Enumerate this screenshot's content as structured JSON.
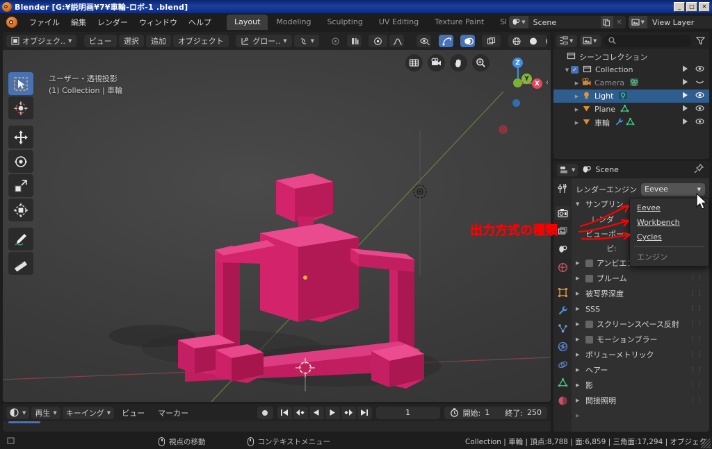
{
  "window": {
    "title": "Blender  [G:¥説明画¥7¥車輪-ロボ-1 .blend]",
    "minimize": "_",
    "maximize": "□",
    "close": "✕"
  },
  "topbar": {
    "menus": [
      "ファイル",
      "編集",
      "レンダー",
      "ウィンドウ",
      "ヘルプ"
    ],
    "workspaces": [
      {
        "label": "Layout",
        "active": true
      },
      {
        "label": "Modeling",
        "active": false
      },
      {
        "label": "Sculpting",
        "active": false
      },
      {
        "label": "UV Editing",
        "active": false
      },
      {
        "label": "Texture Paint",
        "active": false
      },
      {
        "label": "Sha",
        "active": false
      }
    ],
    "scene_name": "Scene",
    "view_layer_name": "View Layer"
  },
  "viewport": {
    "mode": "オブジェク..",
    "menus": [
      "ビュー",
      "選択",
      "追加",
      "オブジェクト"
    ],
    "transform_orientation": "グロー..",
    "overlay_line1": "ユーザー・透視投影",
    "overlay_line2": "(1) Collection | 車輪",
    "gizmo_axes": [
      "Z",
      "Y",
      "X"
    ],
    "tools": [
      "tweak-select-box-tool",
      "cursor-tool",
      "move-tool",
      "rotate-tool",
      "scale-tool",
      "transform-tool",
      "annotate-tool",
      "measure-tool"
    ],
    "nav_buttons": [
      "toggle-camera-grid",
      "camera-view",
      "pan-view",
      "zoom-view"
    ]
  },
  "outliner": {
    "search_placeholder": "",
    "rows": [
      {
        "label": "シーンコレクション",
        "indent": 0,
        "icon": "collection-icon",
        "selected": false,
        "has_disc": false,
        "has_check": false,
        "visible_ico": "",
        "hide_ico": ""
      },
      {
        "label": "Collection",
        "indent": 1,
        "icon": "collection-icon",
        "selected": false,
        "has_disc": true,
        "has_check": true,
        "visible_ico": "▶",
        "hide_ico": "◉"
      },
      {
        "label": "Camera",
        "indent": 2,
        "icon": "camera-icon",
        "selected": false,
        "has_disc": true,
        "has_check": false,
        "visible_ico": "▶",
        "hide_ico": "◡",
        "dim": true
      },
      {
        "label": "Light",
        "indent": 2,
        "icon": "light-icon",
        "selected": true,
        "has_disc": true,
        "has_check": false,
        "visible_ico": "▶",
        "hide_ico": "◉"
      },
      {
        "label": "Plane",
        "indent": 2,
        "icon": "mesh-icon",
        "selected": false,
        "has_disc": true,
        "has_check": false,
        "visible_ico": "▶",
        "hide_ico": "◉"
      },
      {
        "label": "車輪",
        "indent": 2,
        "icon": "mesh-icon",
        "selected": false,
        "has_disc": true,
        "has_check": false,
        "visible_ico": "▶",
        "hide_ico": "◉"
      }
    ]
  },
  "properties": {
    "breadcrumb": "Scene",
    "render_engine_label": "レンダーエンジン",
    "render_engine_value": "Eevee",
    "sampling_label": "サンプリン..",
    "render_sub_label": "レンダ",
    "viewport_sub_label": "ビューポー",
    "pixel_label": "ピ:",
    "dropdown_items": [
      {
        "label": "Eevee",
        "underline": "E",
        "dim": false
      },
      {
        "label": "Workbench",
        "underline": "W",
        "dim": false
      },
      {
        "label": "Cycles",
        "underline": "C",
        "dim": false
      },
      {
        "label": "エンジン",
        "underline": "",
        "dim": true
      }
    ],
    "sections": [
      {
        "label": "アンビエントオクルージョン(:",
        "checkbox": true
      },
      {
        "label": "ブルーム",
        "checkbox": true
      },
      {
        "label": "被写界深度",
        "checkbox": false
      },
      {
        "label": "SSS",
        "checkbox": false
      },
      {
        "label": "スクリーンスペース反射",
        "checkbox": true
      },
      {
        "label": "モーションブラー",
        "checkbox": true
      },
      {
        "label": "ボリューメトリック",
        "checkbox": false
      },
      {
        "label": "ヘアー",
        "checkbox": false
      },
      {
        "label": "影",
        "checkbox": false
      },
      {
        "label": "間接照明",
        "checkbox": false
      }
    ],
    "tabs": [
      "tool-icon",
      "render-icon",
      "output-icon",
      "view-layer-icon",
      "scene-icon",
      "world-icon",
      "object-icon",
      "modifier-icon",
      "particles-icon",
      "physics-icon",
      "constraints-icon",
      "data-icon",
      "material-icon"
    ]
  },
  "annotation": {
    "text": "出力方式の種類",
    "color": "#ff0000"
  },
  "timeline": {
    "playback_label": "再生",
    "keying_label": "キーイング",
    "view_label": "ビュー",
    "marker_label": "マーカー",
    "current_frame": "1",
    "start_label": "開始:",
    "start_value": "1",
    "end_label": "終了:",
    "end_value": "250"
  },
  "statusbar": {
    "mouse_action_left": "視点の移動",
    "mouse_action_right": "コンテキストメニュー",
    "stats": "Collection | 車輪 | 頂点:8,788 | 面:6,859 | 三角面:17,294 | オブジェク"
  },
  "colors": {
    "accent_blue": "#4772b3",
    "object_pink": "#e0256e",
    "annotation_red": "#ff0000",
    "titlebar_blue": "#0a246a"
  }
}
